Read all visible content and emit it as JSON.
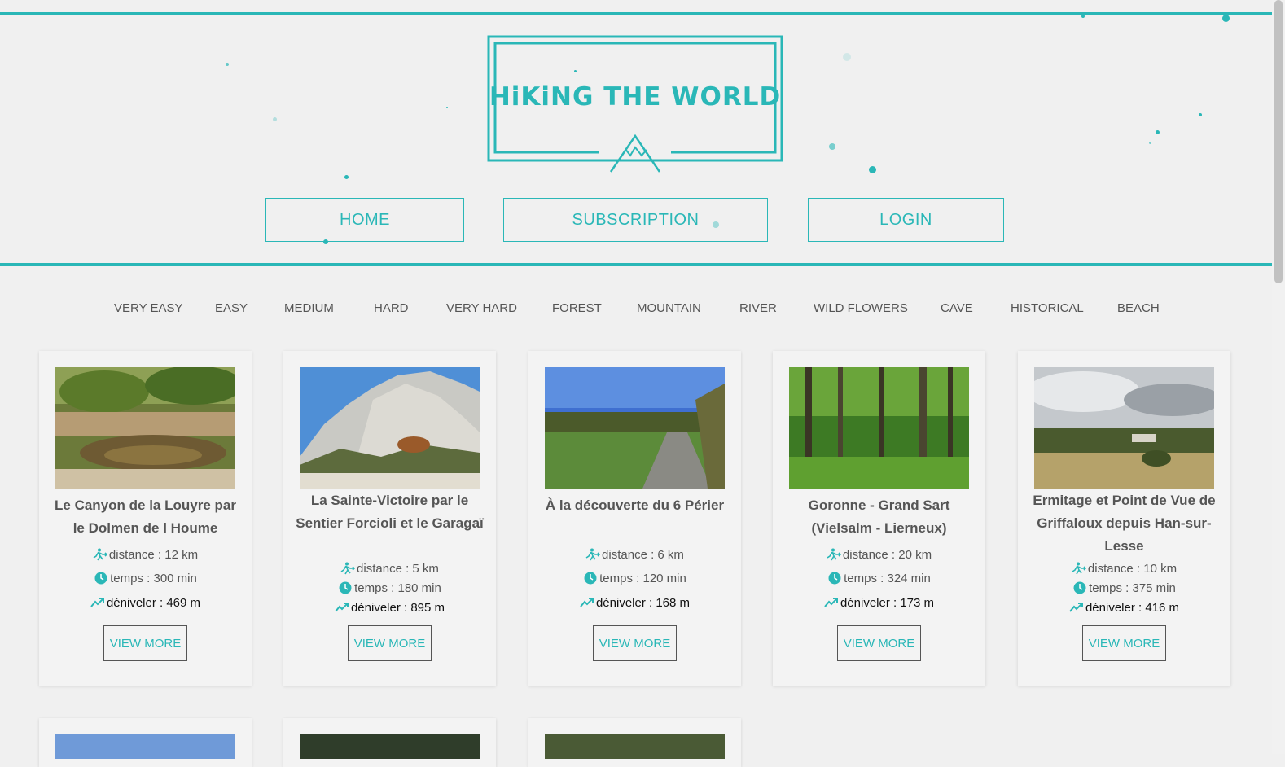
{
  "brand": {
    "title": "HiKiNG THE WORLD",
    "accent": "#2ab7b7"
  },
  "nav": {
    "home": "HOME",
    "subscription": "SUBSCRIPTION",
    "login": "LOGIN"
  },
  "filters": [
    "VERY EASY",
    "EASY",
    "MEDIUM",
    "HARD",
    "VERY HARD",
    "FOREST",
    "MOUNTAIN",
    "RIVER",
    "WILD FLOWERS",
    "CAVE",
    "HISTORICAL",
    "BEACH"
  ],
  "cards": [
    {
      "title": "Le Canyon de la Louyre par le Dolmen de l Houme",
      "distance": "distance : 12 km",
      "temps": "temps : 300 min",
      "deniveler": "déniveler : 469 m",
      "button": "VIEW MORE",
      "image": "canyon-photo"
    },
    {
      "title": "La Sainte-Victoire par le Sentier Forcioli et le Garagaï",
      "distance": "distance : 5 km",
      "temps": "temps : 180 min",
      "deniveler": "déniveler : 895 m",
      "button": "VIEW MORE",
      "image": "rocky-mountain-photo"
    },
    {
      "title": "À la découverte du 6 Périer",
      "distance": "distance : 6 km",
      "temps": "temps : 120 min",
      "deniveler": "déniveler : 168 m",
      "button": "VIEW MORE",
      "image": "country-path-photo"
    },
    {
      "title": "Goronne - Grand Sart (Vielsalm - Lierneux)",
      "distance": "distance : 20 km",
      "temps": "temps : 324 min",
      "deniveler": "déniveler : 173 m",
      "button": "VIEW MORE",
      "image": "forest-photo"
    },
    {
      "title": "Ermitage et Point de Vue de Griffaloux depuis Han-sur-Lesse",
      "distance": "distance : 10 km",
      "temps": "temps : 375 min",
      "deniveler": "déniveler : 416 m",
      "button": "VIEW MORE",
      "image": "cloudy-field-photo"
    }
  ]
}
